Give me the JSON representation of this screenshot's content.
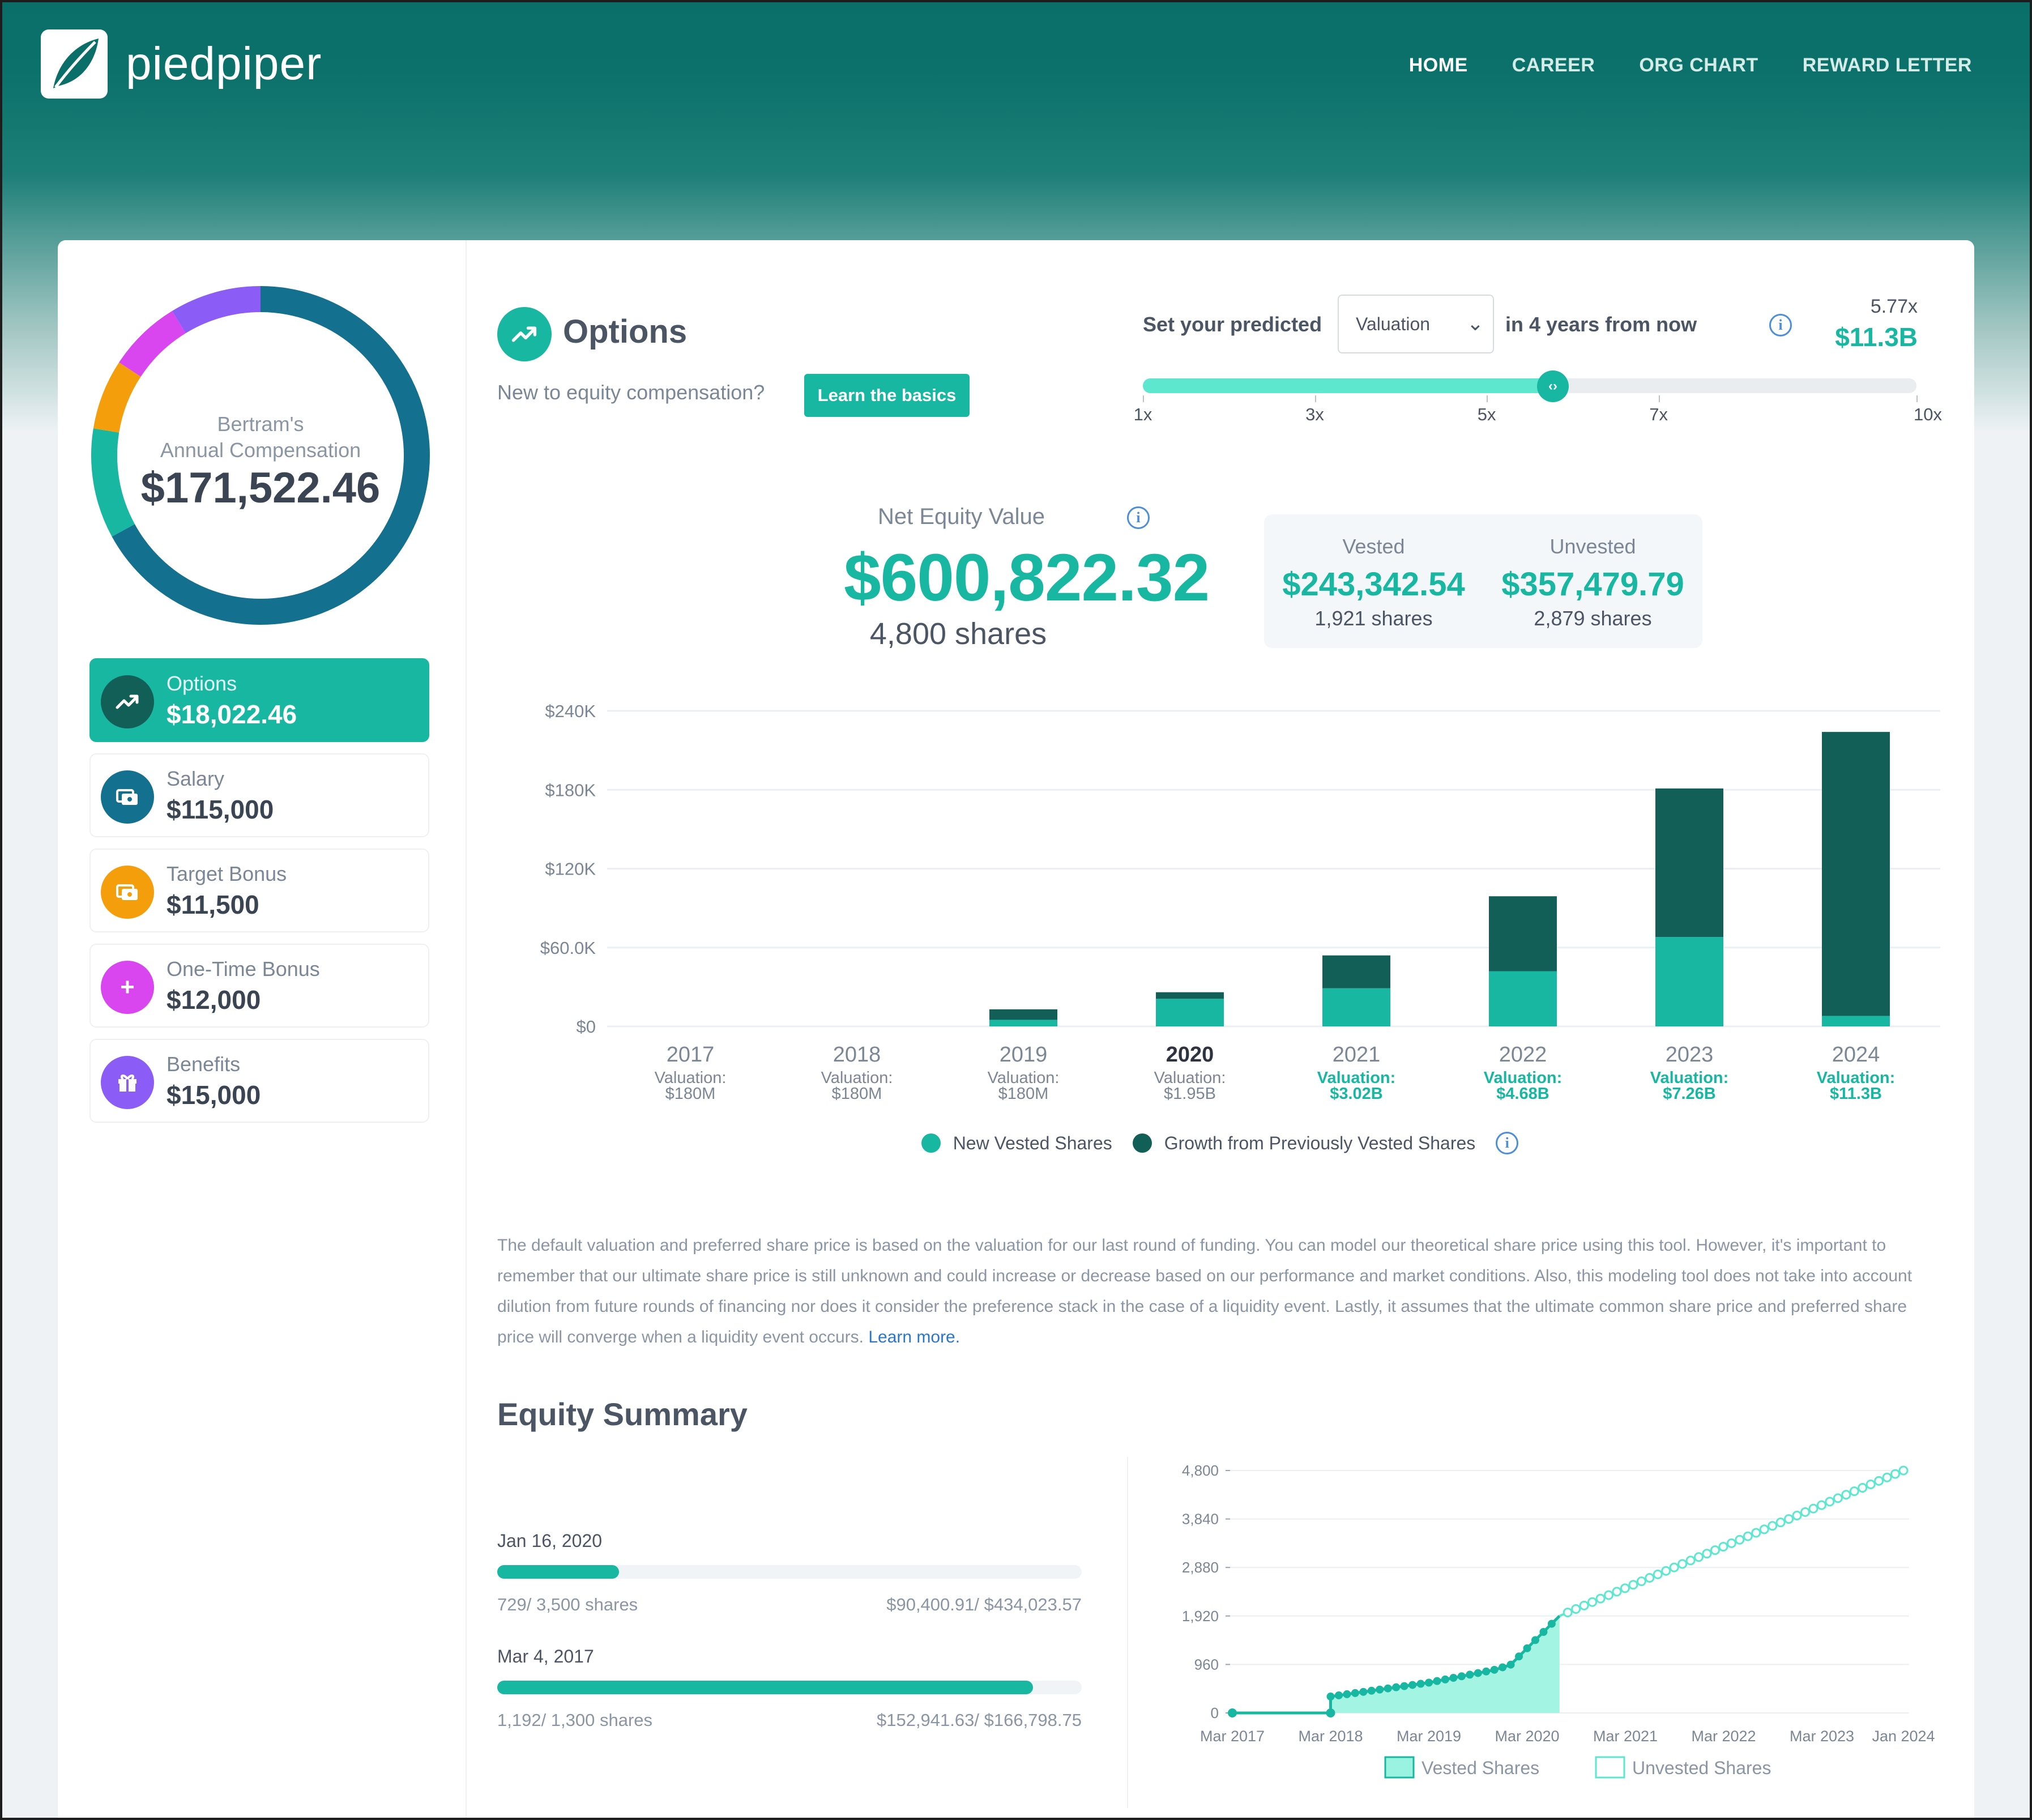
{
  "header": {
    "brand": "piedpiper",
    "nav": [
      {
        "label": "HOME",
        "active": true
      },
      {
        "label": "CAREER",
        "active": false
      },
      {
        "label": "ORG CHART",
        "active": false
      },
      {
        "label": "REWARD LETTER",
        "active": false
      }
    ]
  },
  "sidebar": {
    "donut": {
      "name": "Bertram's",
      "subtitle": "Annual Compensation",
      "total": "$171,522.46",
      "segments": [
        {
          "name": "Salary",
          "value": 115000,
          "color": "#13708f"
        },
        {
          "name": "Options",
          "value": 18022.46,
          "color": "#17b7a2"
        },
        {
          "name": "Target Bonus",
          "value": 11500,
          "color": "#f59e0b"
        },
        {
          "name": "One-Time Bonus",
          "value": 12000,
          "color": "#d946ef"
        },
        {
          "name": "Benefits",
          "value": 15000,
          "color": "#8b5cf6"
        }
      ]
    },
    "items": [
      {
        "label": "Options",
        "value": "$18,022.46",
        "icon": "trending-up-icon",
        "color": "#125f58",
        "active": true
      },
      {
        "label": "Salary",
        "value": "$115,000",
        "icon": "money-icon",
        "color": "#13708f",
        "active": false
      },
      {
        "label": "Target Bonus",
        "value": "$11,500",
        "icon": "money-icon",
        "color": "#f59e0b",
        "active": false
      },
      {
        "label": "One-Time Bonus",
        "value": "$12,000",
        "icon": "plus-icon",
        "color": "#d946ef",
        "active": false
      },
      {
        "label": "Benefits",
        "value": "$15,000",
        "icon": "gift-icon",
        "color": "#8b5cf6",
        "active": false
      }
    ]
  },
  "options": {
    "title": "Options",
    "new_to": "New to equity compensation?",
    "learn_button": "Learn the basics",
    "predict_label": "Set your predicted",
    "select_value": "Valuation",
    "years_label": "in 4 years from now",
    "multiplier": "5.77x",
    "valuation": "$11.3B",
    "slider": {
      "min": 1,
      "max": 10,
      "value": 5.77,
      "ticks": [
        "1x",
        "3x",
        "5x",
        "7x",
        "10x"
      ],
      "tick_values": [
        1,
        3,
        5,
        7,
        10
      ]
    },
    "net_equity_label": "Net Equity Value",
    "net_equity_value": "$600,822.32",
    "total_shares": "4,800 shares",
    "vested_label": "Vested",
    "vested_value": "$243,342.54",
    "vested_shares": "1,921 shares",
    "unvested_label": "Unvested",
    "unvested_value": "$357,479.79",
    "unvested_shares": "2,879 shares"
  },
  "chart_data": [
    {
      "type": "bar",
      "stacked": true,
      "categories": [
        "2017",
        "2018",
        "2019",
        "2020",
        "2021",
        "2022",
        "2023",
        "2024"
      ],
      "category_sublabels": [
        "Valuation:\n$180M",
        "Valuation:\n$180M",
        "Valuation:\n$180M",
        "Valuation:\n$1.95B",
        "Valuation:\n$3.02B",
        "Valuation:\n$4.68B",
        "Valuation:\n$7.26B",
        "Valuation:\n$11.3B"
      ],
      "highlight_category": "2020",
      "projected_from": "2021",
      "series": [
        {
          "name": "New Vested Shares",
          "color": "#17b7a2",
          "values": [
            0,
            0,
            5000,
            21000,
            29000,
            42000,
            68000,
            8000
          ]
        },
        {
          "name": "Growth from Previously Vested Shares",
          "color": "#125f58",
          "values": [
            0,
            0,
            8000,
            5000,
            25000,
            57000,
            113000,
            216000
          ]
        }
      ],
      "yticks": [
        "$0",
        "$60.0K",
        "$120K",
        "$180K",
        "$240K"
      ],
      "ylim": [
        0,
        240000
      ],
      "grid": true,
      "legend": "bottom"
    },
    {
      "type": "area",
      "title": "Equity Summary",
      "x": [
        "Mar 2017",
        "Mar 2018",
        "Mar 2019",
        "Mar 2020",
        "Mar 2021",
        "Mar 2022",
        "Mar 2023",
        "Jan 2024"
      ],
      "xlim_years": [
        2017.17,
        2024.0
      ],
      "yticks": [
        "0",
        "960",
        "1,920",
        "2,880",
        "3,840",
        "4,800"
      ],
      "ylim": [
        0,
        4800
      ],
      "series": [
        {
          "name": "Vested Shares",
          "color": "#17b7a2",
          "points": [
            [
              2017.17,
              0
            ],
            [
              2018.17,
              0
            ],
            [
              2018.17,
              325
            ],
            [
              2019.17,
              600
            ],
            [
              2019.83,
              850
            ],
            [
              2020.0,
              950
            ],
            [
              2020.5,
              1921
            ]
          ]
        },
        {
          "name": "Unvested Shares",
          "color": "#5ee7cf",
          "points": [
            [
              2020.5,
              1921
            ],
            [
              2024.0,
              4800
            ]
          ]
        }
      ],
      "legend": "bottom"
    }
  ],
  "disclaimer": {
    "text": "The default valuation and preferred share price is based on the valuation for our last round of funding. You can model our theoretical share price using this tool. However, it's important to remember that our ultimate share price is still unknown and could increase or decrease based on our performance and market conditions. Also, this modeling tool does not take into account dilution from future rounds of financing nor does it consider the preference stack in the case of a liquidity event. Lastly, it assumes that the ultimate common share price and preferred share price will converge when a liquidity event occurs.",
    "link": "Learn more."
  },
  "equity_summary": {
    "title": "Equity Summary",
    "grants": [
      {
        "date": "Jan 16, 2020",
        "shares": "729/ 3,500 shares",
        "value": "$90,400.91/ $434,023.57",
        "progress": 0.208
      },
      {
        "date": "Mar 4, 2017",
        "shares": "1,192/ 1,300 shares",
        "value": "$152,941.63/ $166,798.75",
        "progress": 0.917
      }
    ]
  }
}
